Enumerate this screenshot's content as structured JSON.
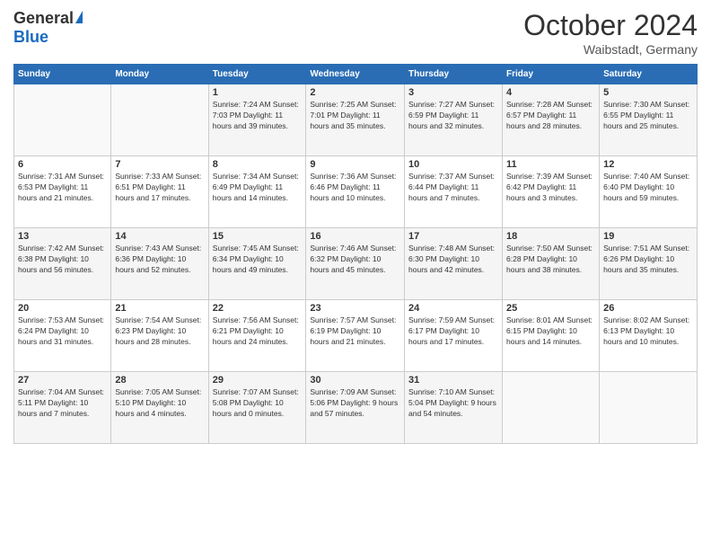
{
  "logo": {
    "general": "General",
    "blue": "Blue"
  },
  "header": {
    "month": "October 2024",
    "location": "Waibstadt, Germany"
  },
  "weekdays": [
    "Sunday",
    "Monday",
    "Tuesday",
    "Wednesday",
    "Thursday",
    "Friday",
    "Saturday"
  ],
  "weeks": [
    [
      {
        "day": "",
        "info": ""
      },
      {
        "day": "",
        "info": ""
      },
      {
        "day": "1",
        "info": "Sunrise: 7:24 AM\nSunset: 7:03 PM\nDaylight: 11 hours\nand 39 minutes."
      },
      {
        "day": "2",
        "info": "Sunrise: 7:25 AM\nSunset: 7:01 PM\nDaylight: 11 hours\nand 35 minutes."
      },
      {
        "day": "3",
        "info": "Sunrise: 7:27 AM\nSunset: 6:59 PM\nDaylight: 11 hours\nand 32 minutes."
      },
      {
        "day": "4",
        "info": "Sunrise: 7:28 AM\nSunset: 6:57 PM\nDaylight: 11 hours\nand 28 minutes."
      },
      {
        "day": "5",
        "info": "Sunrise: 7:30 AM\nSunset: 6:55 PM\nDaylight: 11 hours\nand 25 minutes."
      }
    ],
    [
      {
        "day": "6",
        "info": "Sunrise: 7:31 AM\nSunset: 6:53 PM\nDaylight: 11 hours\nand 21 minutes."
      },
      {
        "day": "7",
        "info": "Sunrise: 7:33 AM\nSunset: 6:51 PM\nDaylight: 11 hours\nand 17 minutes."
      },
      {
        "day": "8",
        "info": "Sunrise: 7:34 AM\nSunset: 6:49 PM\nDaylight: 11 hours\nand 14 minutes."
      },
      {
        "day": "9",
        "info": "Sunrise: 7:36 AM\nSunset: 6:46 PM\nDaylight: 11 hours\nand 10 minutes."
      },
      {
        "day": "10",
        "info": "Sunrise: 7:37 AM\nSunset: 6:44 PM\nDaylight: 11 hours\nand 7 minutes."
      },
      {
        "day": "11",
        "info": "Sunrise: 7:39 AM\nSunset: 6:42 PM\nDaylight: 11 hours\nand 3 minutes."
      },
      {
        "day": "12",
        "info": "Sunrise: 7:40 AM\nSunset: 6:40 PM\nDaylight: 10 hours\nand 59 minutes."
      }
    ],
    [
      {
        "day": "13",
        "info": "Sunrise: 7:42 AM\nSunset: 6:38 PM\nDaylight: 10 hours\nand 56 minutes."
      },
      {
        "day": "14",
        "info": "Sunrise: 7:43 AM\nSunset: 6:36 PM\nDaylight: 10 hours\nand 52 minutes."
      },
      {
        "day": "15",
        "info": "Sunrise: 7:45 AM\nSunset: 6:34 PM\nDaylight: 10 hours\nand 49 minutes."
      },
      {
        "day": "16",
        "info": "Sunrise: 7:46 AM\nSunset: 6:32 PM\nDaylight: 10 hours\nand 45 minutes."
      },
      {
        "day": "17",
        "info": "Sunrise: 7:48 AM\nSunset: 6:30 PM\nDaylight: 10 hours\nand 42 minutes."
      },
      {
        "day": "18",
        "info": "Sunrise: 7:50 AM\nSunset: 6:28 PM\nDaylight: 10 hours\nand 38 minutes."
      },
      {
        "day": "19",
        "info": "Sunrise: 7:51 AM\nSunset: 6:26 PM\nDaylight: 10 hours\nand 35 minutes."
      }
    ],
    [
      {
        "day": "20",
        "info": "Sunrise: 7:53 AM\nSunset: 6:24 PM\nDaylight: 10 hours\nand 31 minutes."
      },
      {
        "day": "21",
        "info": "Sunrise: 7:54 AM\nSunset: 6:23 PM\nDaylight: 10 hours\nand 28 minutes."
      },
      {
        "day": "22",
        "info": "Sunrise: 7:56 AM\nSunset: 6:21 PM\nDaylight: 10 hours\nand 24 minutes."
      },
      {
        "day": "23",
        "info": "Sunrise: 7:57 AM\nSunset: 6:19 PM\nDaylight: 10 hours\nand 21 minutes."
      },
      {
        "day": "24",
        "info": "Sunrise: 7:59 AM\nSunset: 6:17 PM\nDaylight: 10 hours\nand 17 minutes."
      },
      {
        "day": "25",
        "info": "Sunrise: 8:01 AM\nSunset: 6:15 PM\nDaylight: 10 hours\nand 14 minutes."
      },
      {
        "day": "26",
        "info": "Sunrise: 8:02 AM\nSunset: 6:13 PM\nDaylight: 10 hours\nand 10 minutes."
      }
    ],
    [
      {
        "day": "27",
        "info": "Sunrise: 7:04 AM\nSunset: 5:11 PM\nDaylight: 10 hours\nand 7 minutes."
      },
      {
        "day": "28",
        "info": "Sunrise: 7:05 AM\nSunset: 5:10 PM\nDaylight: 10 hours\nand 4 minutes."
      },
      {
        "day": "29",
        "info": "Sunrise: 7:07 AM\nSunset: 5:08 PM\nDaylight: 10 hours\nand 0 minutes."
      },
      {
        "day": "30",
        "info": "Sunrise: 7:09 AM\nSunset: 5:06 PM\nDaylight: 9 hours\nand 57 minutes."
      },
      {
        "day": "31",
        "info": "Sunrise: 7:10 AM\nSunset: 5:04 PM\nDaylight: 9 hours\nand 54 minutes."
      },
      {
        "day": "",
        "info": ""
      },
      {
        "day": "",
        "info": ""
      }
    ]
  ]
}
